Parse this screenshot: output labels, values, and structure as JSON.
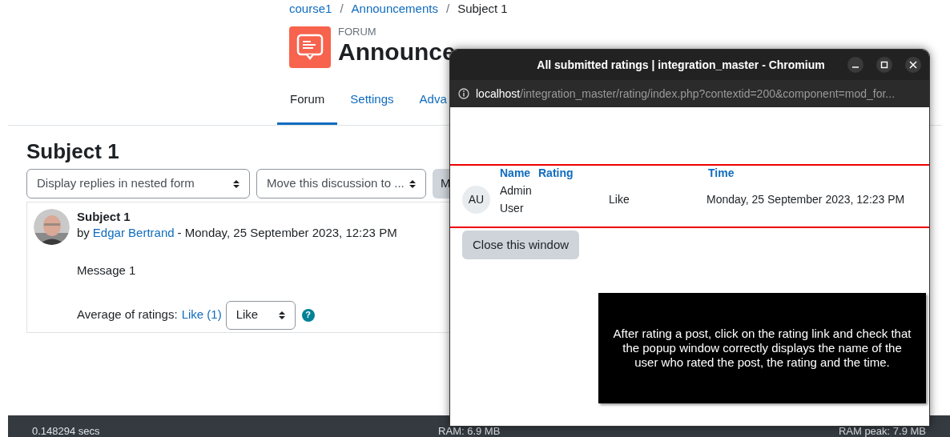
{
  "breadcrumb": [
    {
      "kind": "link",
      "label": "course1"
    },
    {
      "kind": "separator",
      "label": "/"
    },
    {
      "kind": "link",
      "label": "Announcements"
    },
    {
      "kind": "separator",
      "label": "/"
    },
    {
      "kind": "current",
      "label": "Subject 1"
    }
  ],
  "activity": {
    "type_label": "FORUM",
    "title": "Announce"
  },
  "tabs": [
    {
      "label": "Forum",
      "selected": true
    },
    {
      "label": "Settings",
      "selected": false
    },
    {
      "label": "Adva",
      "selected": false
    }
  ],
  "discussion": {
    "title": "Subject 1",
    "display_select": "Display replies in nested form",
    "move_select": "Move this discussion to ...",
    "button": "M"
  },
  "post": {
    "subject": "Subject 1",
    "by": "by",
    "author": "Edgar Bertrand",
    "date": "- Monday, 25 September 2023, 12:23 PM",
    "message": "Message 1",
    "ratings_label": "Average of ratings:",
    "ratings_link": "Like (1)",
    "rating_select": "Like",
    "help": "?"
  },
  "footer": [
    "0.148294 secs",
    "RAM: 6.9 MB",
    "RAM peak: 7.9 MB"
  ],
  "popup": {
    "title": "All submitted ratings | integration_master - Chromium",
    "url_host": "localhost",
    "url_path": "/integration_master/rating/index.php?contextid=200&component=mod_for...",
    "columns": [
      "Name",
      "Rating",
      "Time"
    ],
    "rows": [
      {
        "initials": "AU",
        "name": "Admin User",
        "rating": "Like",
        "time": "Monday, 25 September 2023, 12:23 PM"
      }
    ],
    "close_button": "Close this window"
  },
  "note": "After rating a post, click on the rating link and check that the popup window correctly displays the name of the user who rated the post, the rating and the time."
}
